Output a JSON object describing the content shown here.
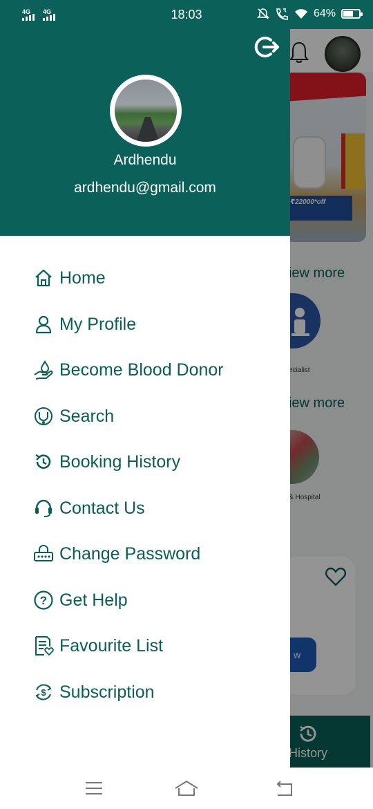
{
  "status_bar": {
    "signal_1": "4G",
    "signal_2": "4G",
    "time": "18:03",
    "battery": "64%",
    "battery_level": 0.64,
    "icons": [
      "mute-icon",
      "volte-call-icon",
      "wifi-icon",
      "battery-icon"
    ]
  },
  "drawer": {
    "user_name": "Ardhendu",
    "user_email": "ardhendu@gmail.com",
    "header_color": "#0b6159",
    "logout_icon": "logout-icon",
    "menu": [
      {
        "label": "Home",
        "icon": "home-icon"
      },
      {
        "label": "My Profile",
        "icon": "user-icon"
      },
      {
        "label": "Become Blood Donor",
        "icon": "blood-donor-icon"
      },
      {
        "label": "Search",
        "icon": "stethoscope-icon"
      },
      {
        "label": "Booking History",
        "icon": "history-icon"
      },
      {
        "label": "Contact Us",
        "icon": "headset-icon"
      },
      {
        "label": "Change Password",
        "icon": "password-icon"
      },
      {
        "label": "Get Help",
        "icon": "help-icon"
      },
      {
        "label": "Favourite List",
        "icon": "favourite-list-icon"
      },
      {
        "label": "Subscription",
        "icon": "subscription-icon"
      }
    ]
  },
  "background_app": {
    "banner_text": "₹22000*off",
    "view_more_1": "View more",
    "view_more_2": "View more",
    "caption_1": "ecialist",
    "caption_2": "& Hospital",
    "card_button": "w",
    "bottom_tab": "History"
  },
  "nav_bar": {
    "buttons": [
      "menu-icon",
      "home-icon",
      "back-icon"
    ]
  },
  "colors": {
    "accent": "#0b6159",
    "menu_text": "#0b5e57",
    "background": "#ffffff"
  }
}
